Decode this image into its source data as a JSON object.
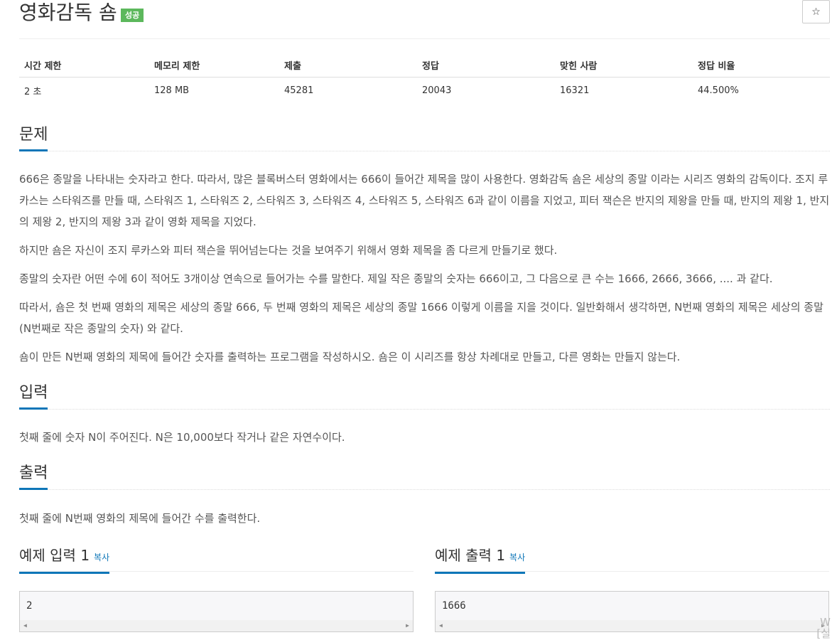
{
  "problem": {
    "title": "영화감독 숌",
    "status_badge": "성공",
    "star_button": "☆"
  },
  "info_table": {
    "headers": [
      "시간 제한",
      "메모리 제한",
      "제출",
      "정답",
      "맞힌 사람",
      "정답 비율"
    ],
    "values": [
      "2 초",
      "128 MB",
      "45281",
      "20043",
      "16321",
      "44.500%"
    ]
  },
  "sections": {
    "description_title": "문제",
    "description": [
      "666은 종말을 나타내는 숫자라고 한다. 따라서, 많은 블록버스터 영화에서는 666이 들어간 제목을 많이 사용한다. 영화감독 숌은 세상의 종말 이라는 시리즈 영화의 감독이다. 조지 루카스는 스타워즈를 만들 때, 스타워즈 1, 스타워즈 2, 스타워즈 3, 스타워즈 4, 스타워즈 5, 스타워즈 6과 같이 이름을 지었고, 피터 잭슨은 반지의 제왕을 만들 때, 반지의 제왕 1, 반지의 제왕 2, 반지의 제왕 3과 같이 영화 제목을 지었다.",
      "하지만 숌은 자신이 조지 루카스와 피터 잭슨을 뛰어넘는다는 것을 보여주기 위해서 영화 제목을 좀 다르게 만들기로 했다.",
      "종말의 숫자란 어떤 수에 6이 적어도 3개이상 연속으로 들어가는 수를 말한다. 제일 작은 종말의 숫자는 666이고, 그 다음으로 큰 수는 1666, 2666, 3666, .... 과 같다.",
      "따라서, 숌은 첫 번째 영화의 제목은 세상의 종말 666, 두 번째 영화의 제목은 세상의 종말 1666 이렇게 이름을 지을 것이다. 일반화해서 생각하면, N번째 영화의 제목은 세상의 종말 (N번째로 작은 종말의 숫자) 와 같다.",
      "숌이 만든 N번째 영화의 제목에 들어간 숫자를 출력하는 프로그램을 작성하시오. 숌은 이 시리즈를 항상 차례대로 만들고, 다른 영화는 만들지 않는다."
    ],
    "input_title": "입력",
    "input_text": "첫째 줄에 숫자 N이 주어진다. N은 10,000보다 작거나 같은 자연수이다.",
    "output_title": "출력",
    "output_text": "첫째 줄에 N번째 영화의 제목에 들어간 수를 출력한다."
  },
  "examples": {
    "input_title": "예제 입력 1",
    "output_title": "예제 출력 1",
    "copy_label": "복사",
    "input_value": "2",
    "output_value": "1666"
  },
  "corner_text": "W\n[실"
}
